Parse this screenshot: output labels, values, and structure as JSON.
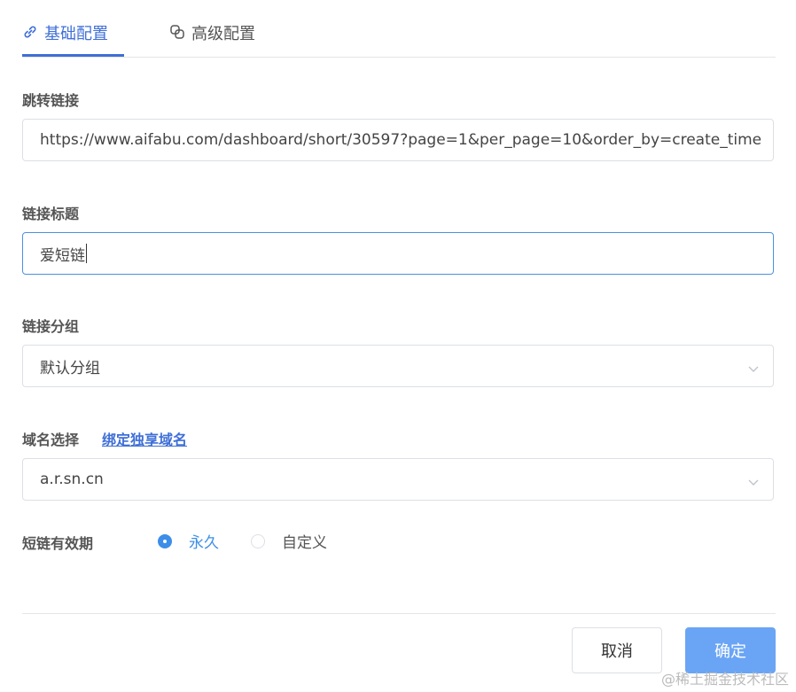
{
  "tabs": [
    {
      "label": "基础配置",
      "icon": "link-icon",
      "active": true
    },
    {
      "label": "高级配置",
      "icon": "layers-icon",
      "active": false
    }
  ],
  "fields": {
    "url": {
      "label": "跳转链接",
      "value": "https://www.aifabu.com/dashboard/short/30597?page=1&per_page=10&order_by=create_time"
    },
    "title": {
      "label": "链接标题",
      "value": "爱短链"
    },
    "group": {
      "label": "链接分组",
      "value": "默认分组"
    },
    "domain": {
      "label": "域名选择",
      "link": "绑定独享域名",
      "value": "a.r.sn.cn"
    }
  },
  "validity": {
    "label": "短链有效期",
    "options": [
      {
        "label": "永久",
        "checked": true
      },
      {
        "label": "自定义",
        "checked": false
      }
    ]
  },
  "buttons": {
    "cancel": "取消",
    "confirm": "确定"
  },
  "watermark": "@稀土掘金技术社区",
  "colors": {
    "accent": "#3f6fd7",
    "radio": "#3c8ee8",
    "primary_button": "#6aa5f5"
  }
}
